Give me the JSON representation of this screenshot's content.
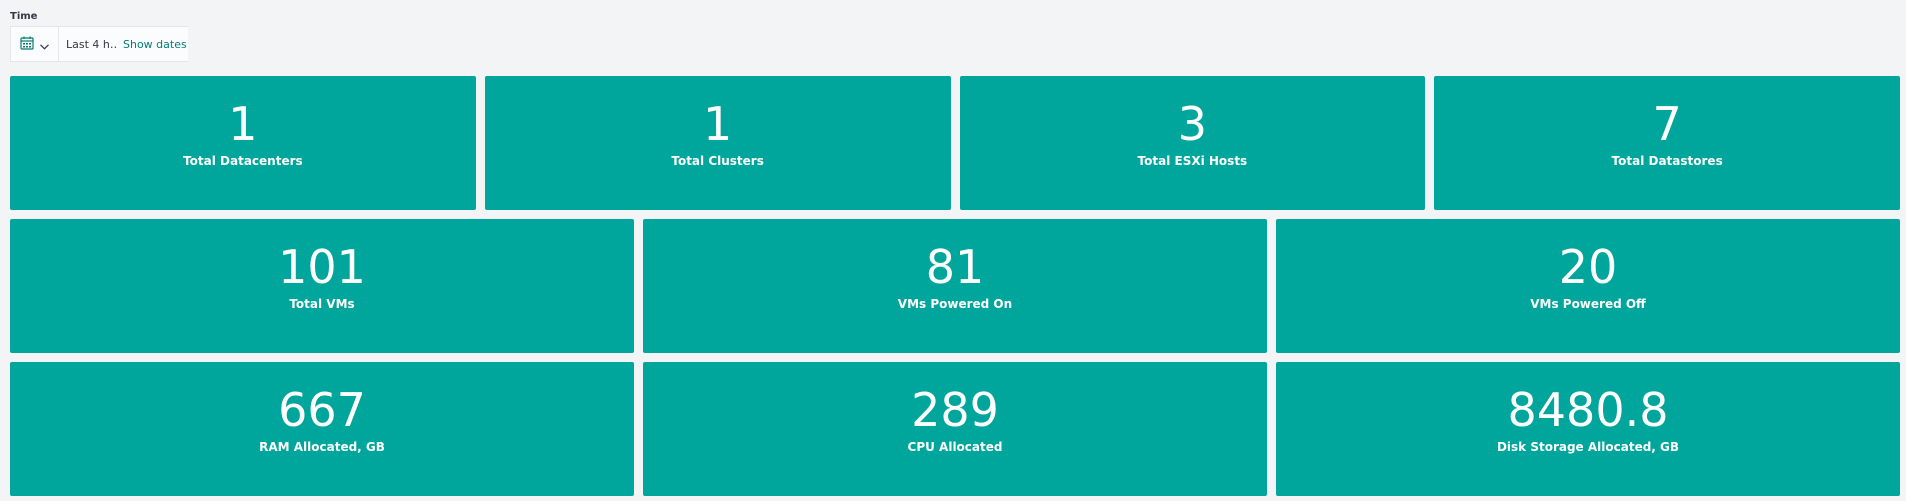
{
  "time_filter": {
    "label": "Time",
    "range": "Last 4 h…",
    "show_dates": "Show dates"
  },
  "rows": [
    [
      {
        "value": "1",
        "label": "Total Datacenters"
      },
      {
        "value": "1",
        "label": "Total Clusters"
      },
      {
        "value": "3",
        "label": "Total ESXi Hosts"
      },
      {
        "value": "7",
        "label": "Total Datastores"
      }
    ],
    [
      {
        "value": "101",
        "label": "Total VMs"
      },
      {
        "value": "81",
        "label": "VMs Powered On"
      },
      {
        "value": "20",
        "label": "VMs Powered Off"
      }
    ],
    [
      {
        "value": "667",
        "label": "RAM Allocated, GB"
      },
      {
        "value": "289",
        "label": "CPU Allocated"
      },
      {
        "value": "8480.8",
        "label": "Disk Storage Allocated, GB"
      }
    ]
  ],
  "colors": {
    "tile": "#00a69b",
    "link": "#017d73",
    "background": "#f3f4f6"
  },
  "icons": {
    "quick_menu": "calendar-icon",
    "dropdown": "chevron-down-icon"
  }
}
